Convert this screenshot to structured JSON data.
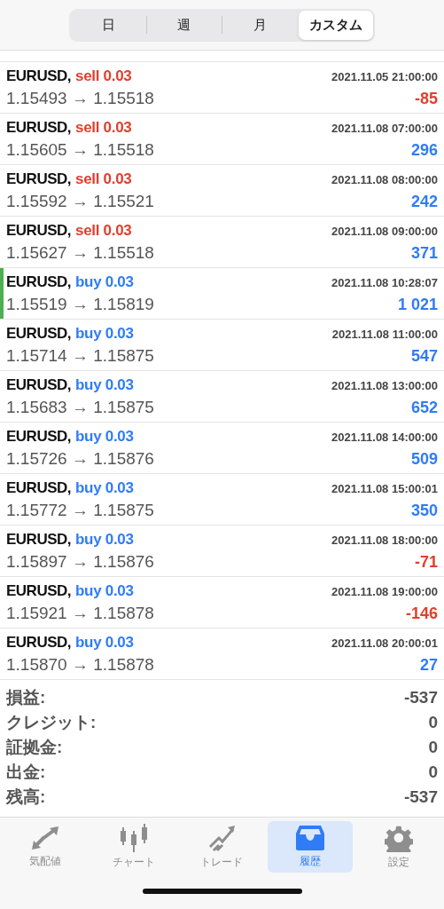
{
  "period_tabs": [
    {
      "label": "日",
      "selected": false
    },
    {
      "label": "週",
      "selected": false
    },
    {
      "label": "月",
      "selected": false
    },
    {
      "label": "カスタム",
      "selected": true
    }
  ],
  "deals": [
    {
      "symbol": "EURUSD,",
      "kind": "sell",
      "deal": "sell 0.03",
      "time": "2021.11.05 21:00:00",
      "prices": "1.15493 → 1.15518",
      "profit": {
        "text": "-85",
        "color": "#e0402e"
      },
      "selected": false
    },
    {
      "symbol": "EURUSD,",
      "kind": "sell",
      "deal": "sell 0.03",
      "time": "2021.11.08 07:00:00",
      "prices": "1.15605 → 1.15518",
      "profit": {
        "text": "296",
        "color": "#2f7cf6"
      },
      "selected": false
    },
    {
      "symbol": "EURUSD,",
      "kind": "sell",
      "deal": "sell 0.03",
      "time": "2021.11.08 08:00:00",
      "prices": "1.15592 → 1.15521",
      "profit": {
        "text": "242",
        "color": "#2f7cf6"
      },
      "selected": false
    },
    {
      "symbol": "EURUSD,",
      "kind": "sell",
      "deal": "sell 0.03",
      "time": "2021.11.08 09:00:00",
      "prices": "1.15627 → 1.15518",
      "profit": {
        "text": "371",
        "color": "#2f7cf6"
      },
      "selected": false
    },
    {
      "symbol": "EURUSD,",
      "kind": "buy",
      "deal": "buy 0.03",
      "time": "2021.11.08 10:28:07",
      "prices": "1.15519 → 1.15819",
      "profit": {
        "text": "1 021",
        "color": "#2f7cf6"
      },
      "selected": true
    },
    {
      "symbol": "EURUSD,",
      "kind": "buy",
      "deal": "buy 0.03",
      "time": "2021.11.08 11:00:00",
      "prices": "1.15714 → 1.15875",
      "profit": {
        "text": "547",
        "color": "#2f7cf6"
      },
      "selected": false
    },
    {
      "symbol": "EURUSD,",
      "kind": "buy",
      "deal": "buy 0.03",
      "time": "2021.11.08 13:00:00",
      "prices": "1.15683 → 1.15875",
      "profit": {
        "text": "652",
        "color": "#2f7cf6"
      },
      "selected": false
    },
    {
      "symbol": "EURUSD,",
      "kind": "buy",
      "deal": "buy 0.03",
      "time": "2021.11.08 14:00:00",
      "prices": "1.15726 → 1.15876",
      "profit": {
        "text": "509",
        "color": "#2f7cf6"
      },
      "selected": false
    },
    {
      "symbol": "EURUSD,",
      "kind": "buy",
      "deal": "buy 0.03",
      "time": "2021.11.08 15:00:01",
      "prices": "1.15772 → 1.15875",
      "profit": {
        "text": "350",
        "color": "#2f7cf6"
      },
      "selected": false
    },
    {
      "symbol": "EURUSD,",
      "kind": "buy",
      "deal": "buy 0.03",
      "time": "2021.11.08 18:00:00",
      "prices": "1.15897 → 1.15876",
      "profit": {
        "text": "-71",
        "color": "#e0402e"
      },
      "selected": false
    },
    {
      "symbol": "EURUSD,",
      "kind": "buy",
      "deal": "buy 0.03",
      "time": "2021.11.08 19:00:00",
      "prices": "1.15921 → 1.15878",
      "profit": {
        "text": "-146",
        "color": "#e0402e"
      },
      "selected": false
    },
    {
      "symbol": "EURUSD,",
      "kind": "buy",
      "deal": "buy 0.03",
      "time": "2021.11.08 20:00:01",
      "prices": "1.15870 → 1.15878",
      "profit": {
        "text": "27",
        "color": "#2f7cf6"
      },
      "selected": false
    }
  ],
  "summary": [
    {
      "label": "損益:",
      "value": "-537"
    },
    {
      "label": "クレジット:",
      "value": "0"
    },
    {
      "label": "証拠金:",
      "value": "0"
    },
    {
      "label": "出金:",
      "value": "0"
    },
    {
      "label": "残高:",
      "value": "-537"
    }
  ],
  "tab_bar": [
    {
      "kind": "quotes",
      "label": "気配値",
      "selected": false
    },
    {
      "kind": "chart",
      "label": "チャート",
      "selected": false
    },
    {
      "kind": "trade",
      "label": "トレード",
      "selected": false
    },
    {
      "kind": "history",
      "label": "履歴",
      "selected": true
    },
    {
      "kind": "settings",
      "label": "設定",
      "selected": false
    }
  ]
}
